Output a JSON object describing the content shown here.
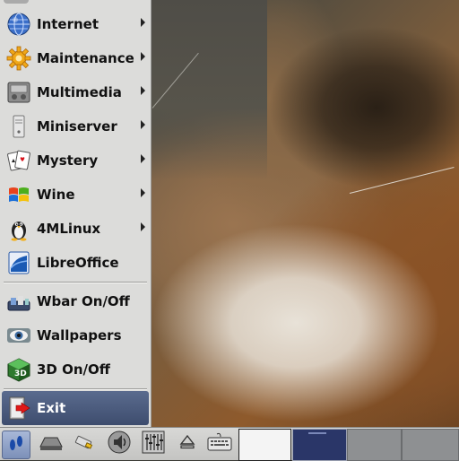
{
  "menu": {
    "items": [
      {
        "label": "Internet",
        "icon": "globe-icon",
        "submenu": true
      },
      {
        "label": "Maintenance",
        "icon": "gear-icon",
        "submenu": true
      },
      {
        "label": "Multimedia",
        "icon": "media-player-icon",
        "submenu": true
      },
      {
        "label": "Miniserver",
        "icon": "server-icon",
        "submenu": true
      },
      {
        "label": "Mystery",
        "icon": "playing-cards-icon",
        "submenu": true
      },
      {
        "label": "Wine",
        "icon": "windows-flag-icon",
        "submenu": true
      },
      {
        "label": "4MLinux",
        "icon": "tux-penguin-icon",
        "submenu": true
      },
      {
        "label": "LibreOffice",
        "icon": "libreoffice-icon",
        "submenu": false
      }
    ],
    "tools": [
      {
        "label": "Wbar On/Off",
        "icon": "wbar-icon"
      },
      {
        "label": "Wallpapers",
        "icon": "eye-icon"
      },
      {
        "label": "3D On/Off",
        "icon": "3d-cube-icon"
      }
    ],
    "exit": {
      "label": "Exit",
      "icon": "exit-door-icon"
    }
  },
  "taskbar": {
    "buttons": [
      {
        "icon": "footprint-menu-icon"
      },
      {
        "icon": "file-manager-icon"
      },
      {
        "icon": "usb-drive-icon"
      },
      {
        "icon": "speaker-volume-icon"
      },
      {
        "icon": "mixer-sliders-icon"
      },
      {
        "icon": "eject-icon"
      },
      {
        "icon": "keyboard-icon"
      }
    ],
    "desktops": 4,
    "active_desktop": 2
  },
  "colors": {
    "menu_bg": "#dcdcda",
    "exit_bg": "#4a5a7c",
    "pager_active": "#2a3668",
    "pager_inactive": "#8e9092"
  }
}
